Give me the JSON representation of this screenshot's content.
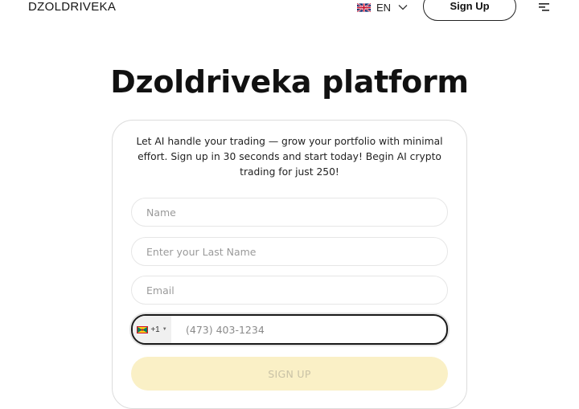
{
  "header": {
    "logo": "DZOLDRIVEKA",
    "language": "EN",
    "signup_label": "Sign Up"
  },
  "main": {
    "title": "Dzoldriveka platform",
    "intro": "Let AI handle your trading — grow your portfolio with minimal effort. Sign up in 30 seconds and start today! Begin AI crypto trading for just 250!"
  },
  "form": {
    "name_placeholder": "Name",
    "last_name_placeholder": "Enter your Last Name",
    "email_placeholder": "Email",
    "country_code": "+1",
    "phone_placeholder": "(473) 403-1234",
    "submit_label": "SIGN UP"
  },
  "icons": {
    "language_flag": "uk-flag-icon",
    "country_flag": "grenada-flag-icon",
    "menu": "menu-icon",
    "chevron": "chevron-down-icon"
  },
  "colors": {
    "submit_bg": "#faf0c6",
    "submit_text": "#c9c2a6",
    "border": "#dcdcdc"
  }
}
